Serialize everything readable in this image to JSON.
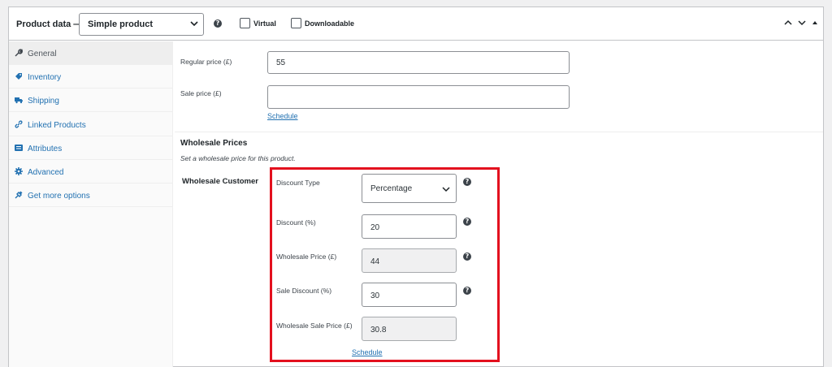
{
  "header": {
    "title": "Product data —",
    "product_type": "Simple product",
    "virtual_label": "Virtual",
    "downloadable_label": "Downloadable"
  },
  "sidebar": {
    "items": [
      {
        "label": "General",
        "icon": "wrench-icon"
      },
      {
        "label": "Inventory",
        "icon": "tag-icon"
      },
      {
        "label": "Shipping",
        "icon": "truck-icon"
      },
      {
        "label": "Linked Products",
        "icon": "link-icon"
      },
      {
        "label": "Attributes",
        "icon": "list-icon"
      },
      {
        "label": "Advanced",
        "icon": "gear-icon"
      },
      {
        "label": "Get more options",
        "icon": "plug-icon"
      }
    ]
  },
  "general": {
    "regular_price_label": "Regular price (£)",
    "regular_price_value": "55",
    "sale_price_label": "Sale price (£)",
    "sale_price_value": "",
    "schedule_label": "Schedule"
  },
  "wholesale": {
    "title": "Wholesale Prices",
    "description": "Set a wholesale price for this product.",
    "customer_label": "Wholesale Customer",
    "discount_type_label": "Discount Type",
    "discount_type_value": "Percentage",
    "discount_label": "Discount (%)",
    "discount_value": "20",
    "wholesale_price_label": "Wholesale Price (£)",
    "wholesale_price_value": "44",
    "sale_discount_label": "Sale Discount (%)",
    "sale_discount_value": "30",
    "wholesale_sale_price_label": "Wholesale Sale Price (£)",
    "wholesale_sale_price_value": "30.8",
    "schedule_label": "Schedule"
  },
  "colors": {
    "link": "#2271b1",
    "highlight": "#e3101e",
    "active_tab": "#eeeeee"
  }
}
